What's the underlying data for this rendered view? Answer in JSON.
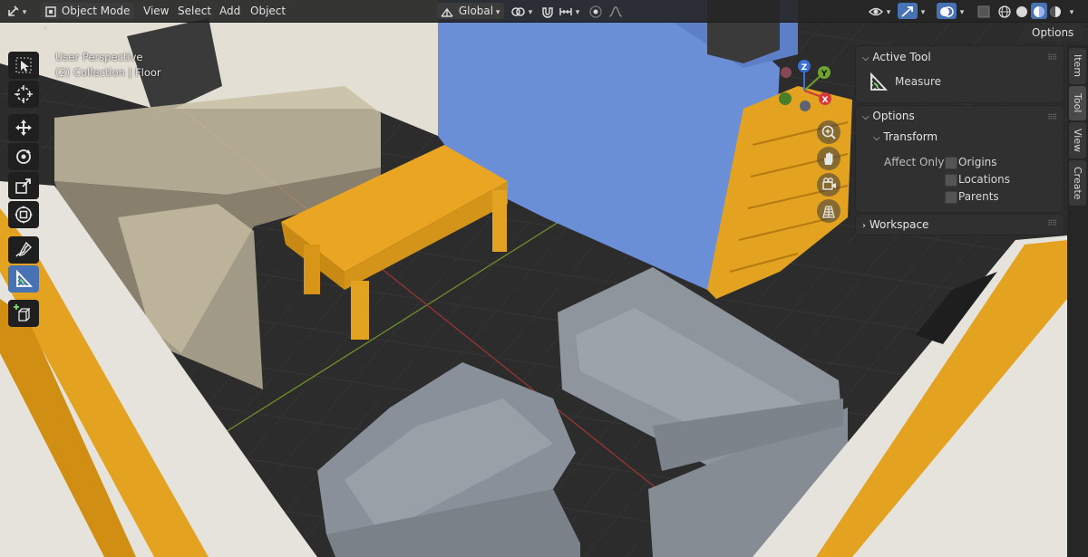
{
  "header": {
    "mode_label": "Object Mode",
    "menus": [
      "View",
      "Select",
      "Add",
      "Object"
    ],
    "orientation_label": "Global"
  },
  "options_button": "Options",
  "viewport_info": {
    "line1": "User Perspective",
    "line2": "(2) Collection | Floor"
  },
  "gizmo": {
    "z": "Z",
    "y": "Y",
    "x": "X"
  },
  "panel": {
    "active_tool_title": "Active Tool",
    "active_tool_name": "Measure",
    "options_title": "Options",
    "transform_title": "Transform",
    "affect_only_label": "Affect Only",
    "checkboxes": [
      {
        "label": "Origins",
        "checked": false
      },
      {
        "label": "Locations",
        "checked": false
      },
      {
        "label": "Parents",
        "checked": false
      }
    ],
    "workspace_title": "Workspace"
  },
  "sidebar_tabs": [
    "Item",
    "Tool",
    "View",
    "Create"
  ],
  "colors": {
    "accent": "#4772b3",
    "orange": "#e3a320",
    "blue_wall": "#6a8fd6",
    "sofa": "#8a9099"
  }
}
